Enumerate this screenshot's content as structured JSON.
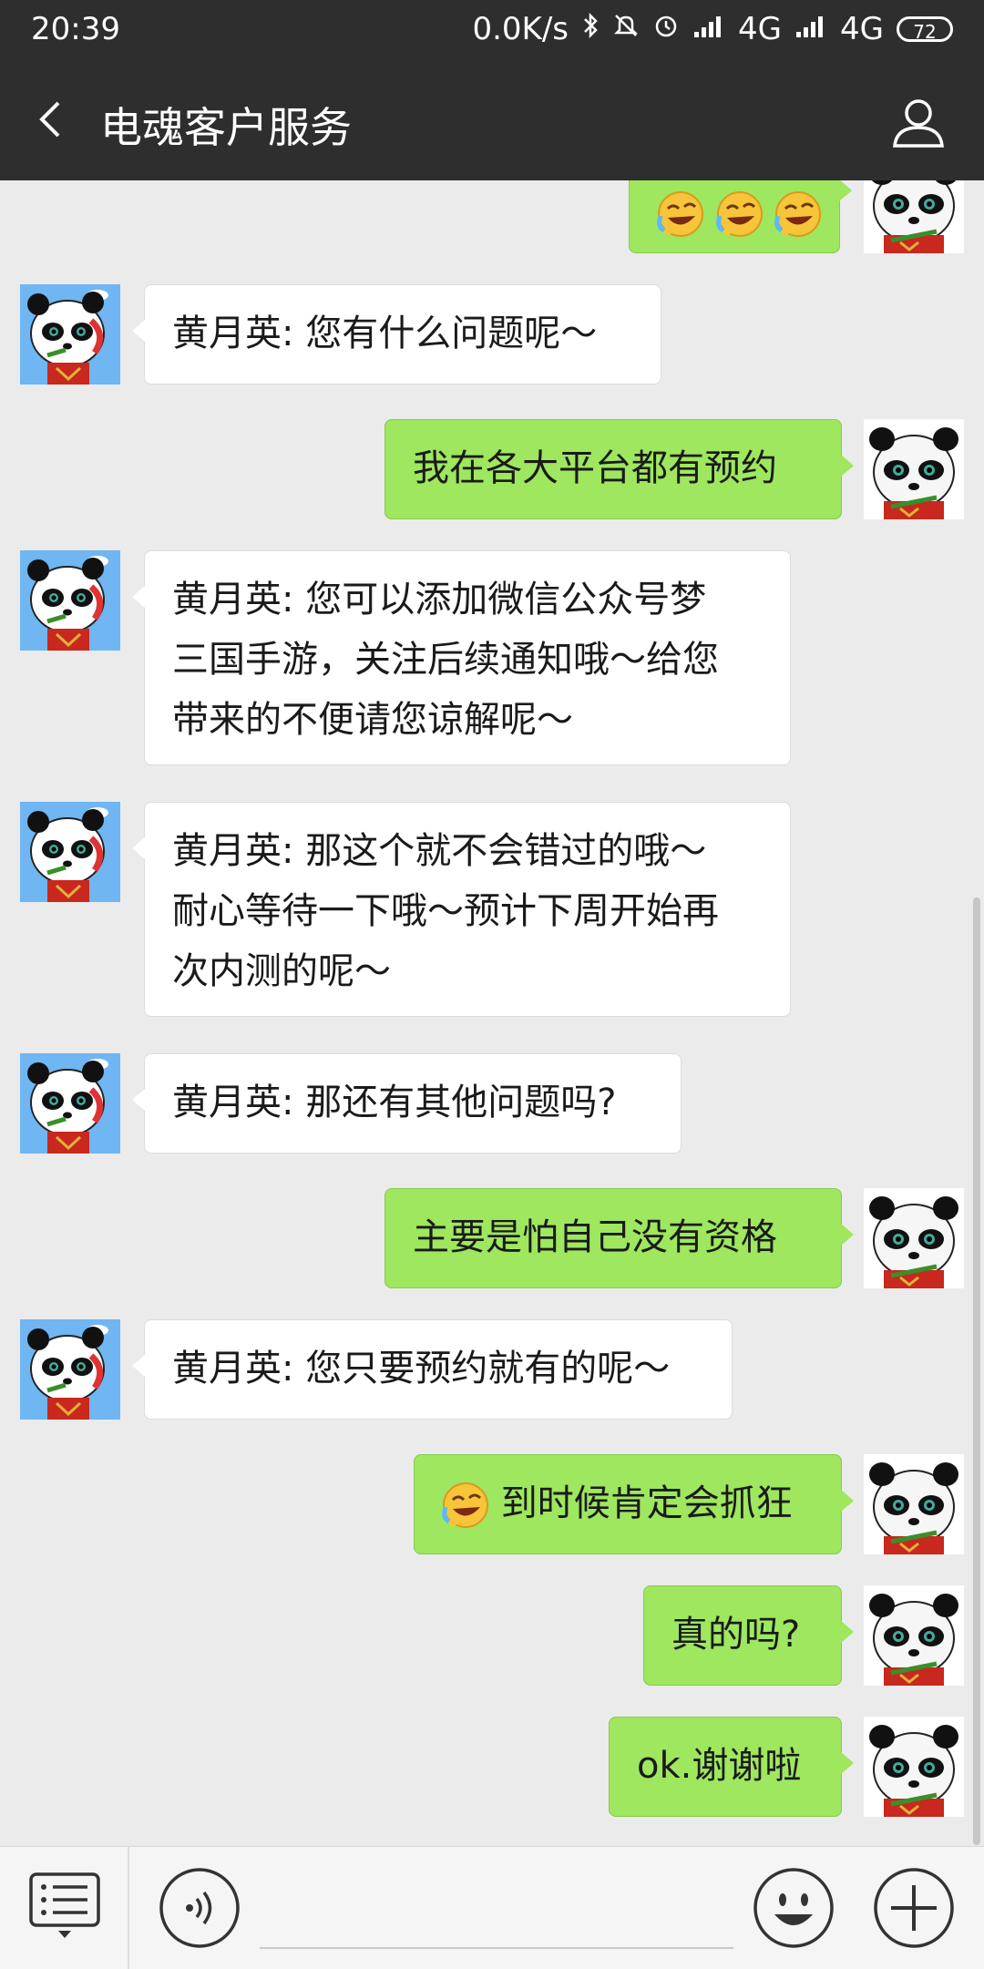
{
  "status": {
    "time": "20:39",
    "speed": "0.0K/s",
    "net1": "4G",
    "net2": "4G",
    "battery": "72"
  },
  "header": {
    "title": "电魂客户服务"
  },
  "messages": [
    {
      "side": "right",
      "text": "",
      "emoji_count": 3
    },
    {
      "side": "left",
      "text": "黄月英: 您有什么问题呢～"
    },
    {
      "side": "right",
      "text": "我在各大平台都有预约"
    },
    {
      "side": "left",
      "line1": "黄月英: 您可以添加微信公众号梦",
      "line2": "三国手游，关注后续通知哦～给您",
      "line3": "带来的不便请您谅解呢～"
    },
    {
      "side": "left",
      "line1": "黄月英: 那这个就不会错过的哦～",
      "line2": "耐心等待一下哦～预计下周开始再",
      "line3": "次内测的呢～"
    },
    {
      "side": "left",
      "text": "黄月英: 那还有其他问题吗?"
    },
    {
      "side": "right",
      "text": "主要是怕自己没有资格"
    },
    {
      "side": "left",
      "text": "黄月英: 您只要预约就有的呢～"
    },
    {
      "side": "right",
      "text": "到时候肯定会抓狂",
      "emoji_count": 1
    },
    {
      "side": "right",
      "text": "真的吗?"
    },
    {
      "side": "right",
      "text": "ok.谢谢啦"
    }
  ],
  "colors": {
    "header_bg": "#2e2e2e",
    "chat_bg": "#ebebeb",
    "sent_bubble": "#9ee75e",
    "received_bubble": "#ffffff"
  },
  "icons": {
    "back": "back-arrow-icon",
    "profile": "person-icon",
    "menu": "list-menu-icon",
    "voice": "voice-icon",
    "emoji": "smiley-icon",
    "plus": "plus-icon"
  }
}
